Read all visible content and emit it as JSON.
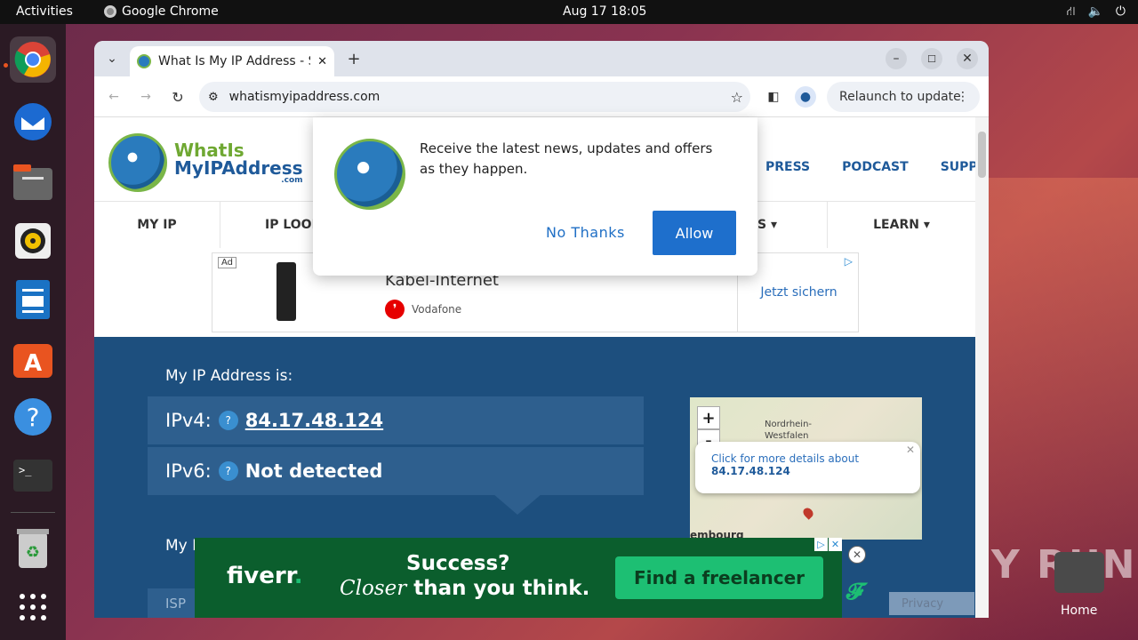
{
  "topbar": {
    "activities": "Activities",
    "app": "Google Chrome",
    "clock": "Aug 17  18:05"
  },
  "dock": {
    "items": [
      "chrome-icon",
      "thunderbird-icon",
      "files-icon",
      "rhythmbox-icon",
      "writer-icon",
      "software-icon",
      "help-icon",
      "terminal-icon",
      "trash-icon",
      "apps-grid-icon"
    ]
  },
  "desktop": {
    "home_label": "Home",
    "watermark": "ANY RUN"
  },
  "browser": {
    "tab_title": "What Is My IP Address - S",
    "url": "whatismyipaddress.com",
    "relaunch": "Relaunch to update"
  },
  "site": {
    "logo_what": "WhatIs",
    "logo_mip": "MyIPAddress",
    "logo_com": ".com",
    "topnav": [
      "PRESS",
      "PODCAST",
      "SUPPORT"
    ],
    "mainnav": [
      "MY IP",
      "IP LOOK",
      "",
      "S ▾",
      "LEARN ▾"
    ],
    "ad_top": {
      "ad": "Ad",
      "headline": "Kabel-Internet",
      "brand": "Vodafone",
      "cta": "Jetzt sichern"
    },
    "hero_label": "My IP Address is:",
    "ipv4_key": "IPv4:",
    "ipv4_value": "84.17.48.124",
    "ipv6_key": "IPv6:",
    "ipv6_value": "Not detected",
    "partial_label": "My I",
    "isp_label": "ISP",
    "map": {
      "region": "Nordrhein-\nWestfalen",
      "popup_text": "Click for more details about",
      "popup_ip": "84.17.48.124",
      "city": "embourg"
    },
    "privacy": "Privacy"
  },
  "ad_bottom": {
    "brand": "fiverr",
    "line1": "Success?",
    "line2_a": "Closer",
    "line2_b": " than you think.",
    "cta": "Find a freelancer"
  },
  "notification": {
    "message": "Receive the latest news, updates and offers as they happen.",
    "deny": "No Thanks",
    "allow": "Allow"
  }
}
